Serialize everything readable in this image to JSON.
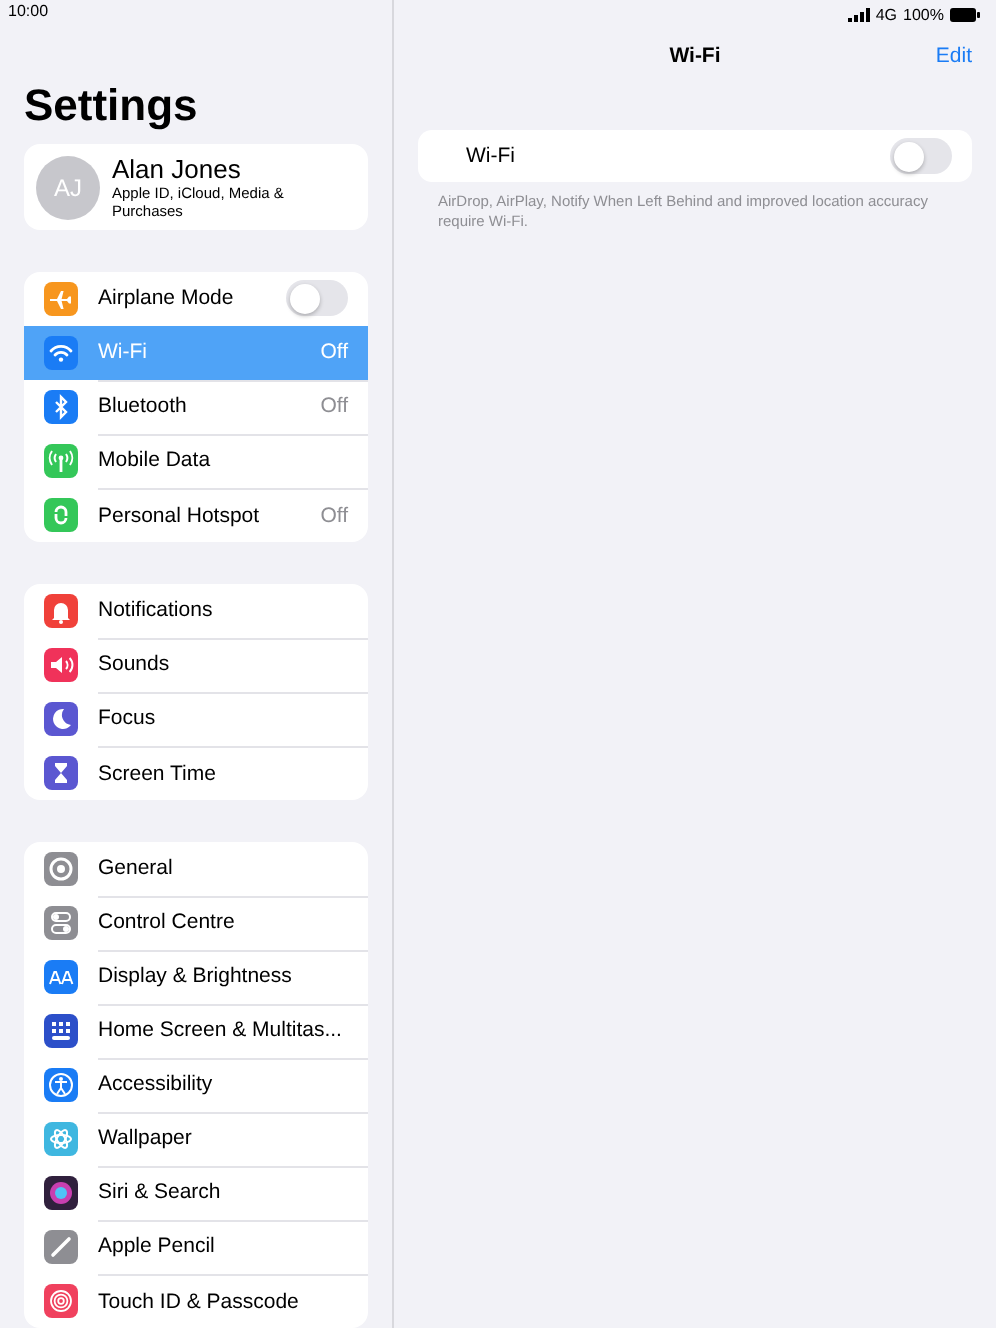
{
  "status_bar": {
    "time": "10:00",
    "network": "4G",
    "battery": "100%"
  },
  "sidebar": {
    "title": "Settings",
    "profile": {
      "initials": "AJ",
      "name": "Alan Jones",
      "subtitle": "Apple ID, iCloud, Media & Purchases"
    },
    "groups": [
      [
        {
          "label": "Airplane Mode",
          "kind": "toggle",
          "on": false,
          "selected": false,
          "color": "#f7961e"
        },
        {
          "label": "Wi-Fi",
          "kind": "value",
          "value": "Off",
          "selected": true,
          "color": "#1a7cf5"
        },
        {
          "label": "Bluetooth",
          "kind": "value",
          "value": "Off",
          "selected": false,
          "color": "#1a7cf5"
        },
        {
          "label": "Mobile Data",
          "kind": "link",
          "selected": false,
          "color": "#34c759"
        },
        {
          "label": "Personal Hotspot",
          "kind": "value",
          "value": "Off",
          "selected": false,
          "color": "#34c759"
        }
      ],
      [
        {
          "label": "Notifications",
          "kind": "link",
          "selected": false,
          "color": "#f0413a"
        },
        {
          "label": "Sounds",
          "kind": "link",
          "selected": false,
          "color": "#f0325a"
        },
        {
          "label": "Focus",
          "kind": "link",
          "selected": false,
          "color": "#5b57d1"
        },
        {
          "label": "Screen Time",
          "kind": "link",
          "selected": false,
          "color": "#5b57d1"
        }
      ],
      [
        {
          "label": "General",
          "kind": "link",
          "selected": false,
          "color": "#8e8e93"
        },
        {
          "label": "Control Centre",
          "kind": "link",
          "selected": false,
          "color": "#8e8e93"
        },
        {
          "label": "Display & Brightness",
          "kind": "link",
          "selected": false,
          "color": "#1a7cf5"
        },
        {
          "label": "Home Screen & Multitas...",
          "kind": "link",
          "selected": false,
          "color": "#2c4fc9"
        },
        {
          "label": "Accessibility",
          "kind": "link",
          "selected": false,
          "color": "#1a7cf5"
        },
        {
          "label": "Wallpaper",
          "kind": "link",
          "selected": false,
          "color": "#3fb7e0"
        },
        {
          "label": "Siri & Search",
          "kind": "link",
          "selected": false,
          "color": "#30203d"
        },
        {
          "label": "Apple Pencil",
          "kind": "link",
          "selected": false,
          "color": "#8e8e93"
        },
        {
          "label": "Touch ID & Passcode",
          "kind": "link",
          "selected": false,
          "color": "#f0415e"
        }
      ]
    ]
  },
  "detail": {
    "title": "Wi-Fi",
    "action": "Edit",
    "setting": {
      "label": "Wi-Fi",
      "on": false
    },
    "footnote": "AirDrop, AirPlay, Notify When Left Behind and improved location accuracy require Wi-Fi."
  }
}
